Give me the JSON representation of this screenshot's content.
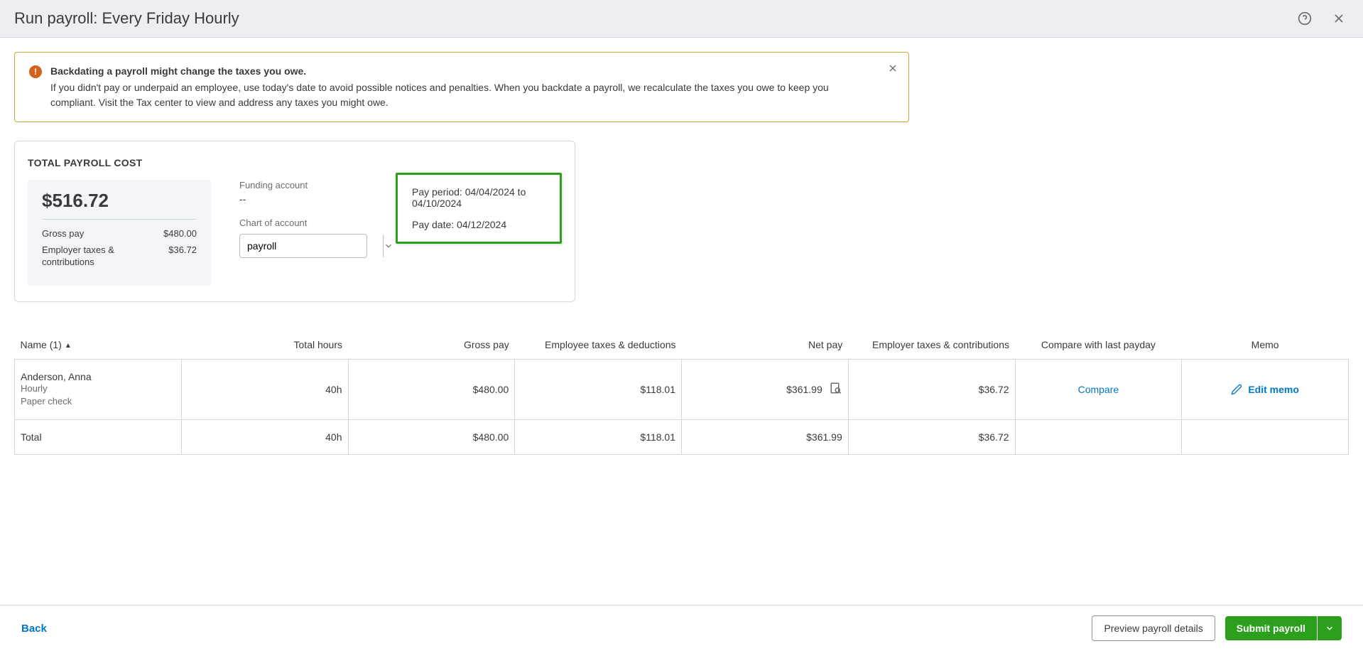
{
  "header": {
    "title": "Run payroll: Every Friday Hourly"
  },
  "alert": {
    "title": "Backdating a payroll might change the taxes you owe.",
    "body": "If you didn't pay or underpaid an employee, use today's date to avoid possible notices and penalties. When you backdate a payroll, we recalculate the taxes you owe to keep you compliant. Visit the Tax center to view and address any taxes you might owe."
  },
  "summary": {
    "title": "TOTAL PAYROLL COST",
    "total": "$516.72",
    "gross_pay_label": "Gross pay",
    "gross_pay_value": "$480.00",
    "employer_tax_label": "Employer taxes & contributions",
    "employer_tax_value": "$36.72",
    "funding_account_label": "Funding account",
    "funding_account_value": "--",
    "chart_of_account_label": "Chart of account",
    "chart_of_account_value": "payroll",
    "pay_period_label": "Pay period: ",
    "pay_period_value": "04/04/2024 to 04/10/2024",
    "pay_date_label": "Pay date: ",
    "pay_date_value": "04/12/2024"
  },
  "table": {
    "headers": {
      "name": "Name (1)",
      "total_hours": "Total hours",
      "gross_pay": "Gross pay",
      "emp_taxes": "Employee taxes & deductions",
      "net_pay": "Net pay",
      "employer_taxes": "Employer taxes & contributions",
      "compare": "Compare with last payday",
      "memo": "Memo"
    },
    "row": {
      "name": "Anderson, Anna",
      "type": "Hourly",
      "method": "Paper check",
      "total_hours": "40h",
      "gross_pay": "$480.00",
      "emp_taxes": "$118.01",
      "net_pay": "$361.99",
      "employer_taxes": "$36.72",
      "compare": "Compare",
      "memo": "Edit memo"
    },
    "totals": {
      "label": "Total",
      "total_hours": "40h",
      "gross_pay": "$480.00",
      "emp_taxes": "$118.01",
      "net_pay": "$361.99",
      "employer_taxes": "$36.72"
    }
  },
  "footer": {
    "back": "Back",
    "preview": "Preview payroll details",
    "submit": "Submit payroll"
  }
}
